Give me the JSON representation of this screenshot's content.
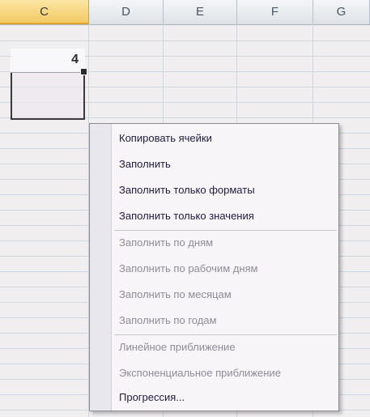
{
  "columns": [
    "C",
    "D",
    "E",
    "F",
    "G"
  ],
  "selected_column": "C",
  "active_cell_value": "4",
  "menu": {
    "items": [
      {
        "label": "Копировать ячейки",
        "enabled": true
      },
      {
        "label": "Заполнить",
        "enabled": true
      },
      {
        "label": "Заполнить только форматы",
        "enabled": true
      },
      {
        "label": "Заполнить только значения",
        "enabled": true
      },
      {
        "label": "Заполнить по дням",
        "enabled": false
      },
      {
        "label": "Заполнить по рабочим дням",
        "enabled": false
      },
      {
        "label": "Заполнить по месяцам",
        "enabled": false
      },
      {
        "label": "Заполнить по годам",
        "enabled": false
      },
      {
        "label": "Линейное приближение",
        "enabled": false
      },
      {
        "label": "Экспоненциальное приближение",
        "enabled": false
      },
      {
        "label": "Прогрессия...",
        "enabled": true
      }
    ]
  }
}
